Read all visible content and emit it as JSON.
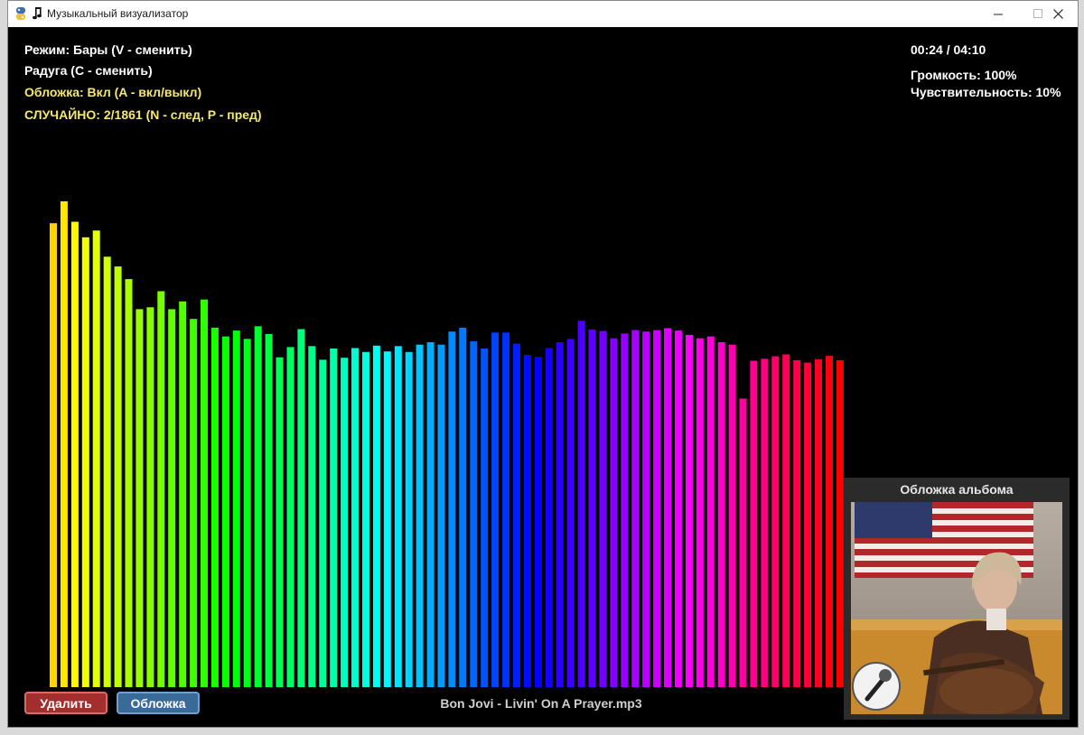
{
  "window": {
    "title": "Музыкальный визуализатор"
  },
  "hud": {
    "mode": "Режим: Бары (V - сменить)",
    "color_mode": "Радуга (C - сменить)",
    "cover_toggle": "Обложка: Вкл (A - вкл/выкл)",
    "shuffle": "СЛУЧАЙНО: 2/1861 (N - след, P - пред)",
    "time": "00:24 / 04:10",
    "volume": "Громкость: 100%",
    "sensitivity": "Чувствительность: 10%"
  },
  "bottom": {
    "delete_label": "Удалить",
    "cover_label": "Обложка",
    "filename": "Bon Jovi - Livin' On A Prayer.mp3"
  },
  "cover_panel": {
    "title": "Обложка альбома"
  },
  "colors": {
    "background": "#000000",
    "hud_white": "#ffffff",
    "hud_yellow": "#f5e86a",
    "delete_button": "#a32e2e",
    "cover_button": "#3a6a98",
    "panel": "#2b2b2b"
  },
  "spectrum": {
    "levels": [
      0.955,
      1.0,
      0.958,
      0.926,
      0.94,
      0.886,
      0.866,
      0.84,
      0.778,
      0.782,
      0.815,
      0.778,
      0.794,
      0.758,
      0.798,
      0.74,
      0.722,
      0.734,
      0.717,
      0.743,
      0.727,
      0.679,
      0.7,
      0.737,
      0.702,
      0.674,
      0.697,
      0.678,
      0.698,
      0.69,
      0.703,
      0.691,
      0.702,
      0.69,
      0.705,
      0.71,
      0.705,
      0.732,
      0.74,
      0.712,
      0.697,
      0.73,
      0.73,
      0.707,
      0.684,
      0.68,
      0.698,
      0.71,
      0.717,
      0.754,
      0.736,
      0.733,
      0.718,
      0.728,
      0.735,
      0.732,
      0.735,
      0.739,
      0.734,
      0.725,
      0.718,
      0.722,
      0.71,
      0.705,
      0.594,
      0.672,
      0.676,
      0.681,
      0.685,
      0.673,
      0.668,
      0.675,
      0.682,
      0.673
    ],
    "color_scale": "rainbow"
  }
}
